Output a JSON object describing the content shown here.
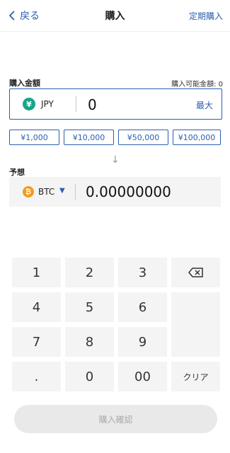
{
  "header": {
    "back_label": "戻る",
    "title": "購入",
    "right_link": "定期購入"
  },
  "purchase": {
    "label": "購入金額",
    "available_label": "購入可能金額: 0",
    "currency": "JPY",
    "amount_value": "0",
    "max_label": "最大",
    "quick_amounts": [
      "¥1,000",
      "¥10,000",
      "¥50,000",
      "¥100,000"
    ]
  },
  "forecast": {
    "label": "予想",
    "currency": "BTC",
    "value": "0.00000000"
  },
  "keypad": {
    "keys": [
      "1",
      "2",
      "3",
      "4",
      "5",
      "6",
      "7",
      "8",
      "9",
      ".",
      "0",
      "00"
    ],
    "clear_label": "クリア"
  },
  "confirm_label": "購入確認",
  "colors": {
    "accent": "#2b5fae",
    "yen_icon": "#17a589",
    "btc_icon": "#f39a1e"
  }
}
